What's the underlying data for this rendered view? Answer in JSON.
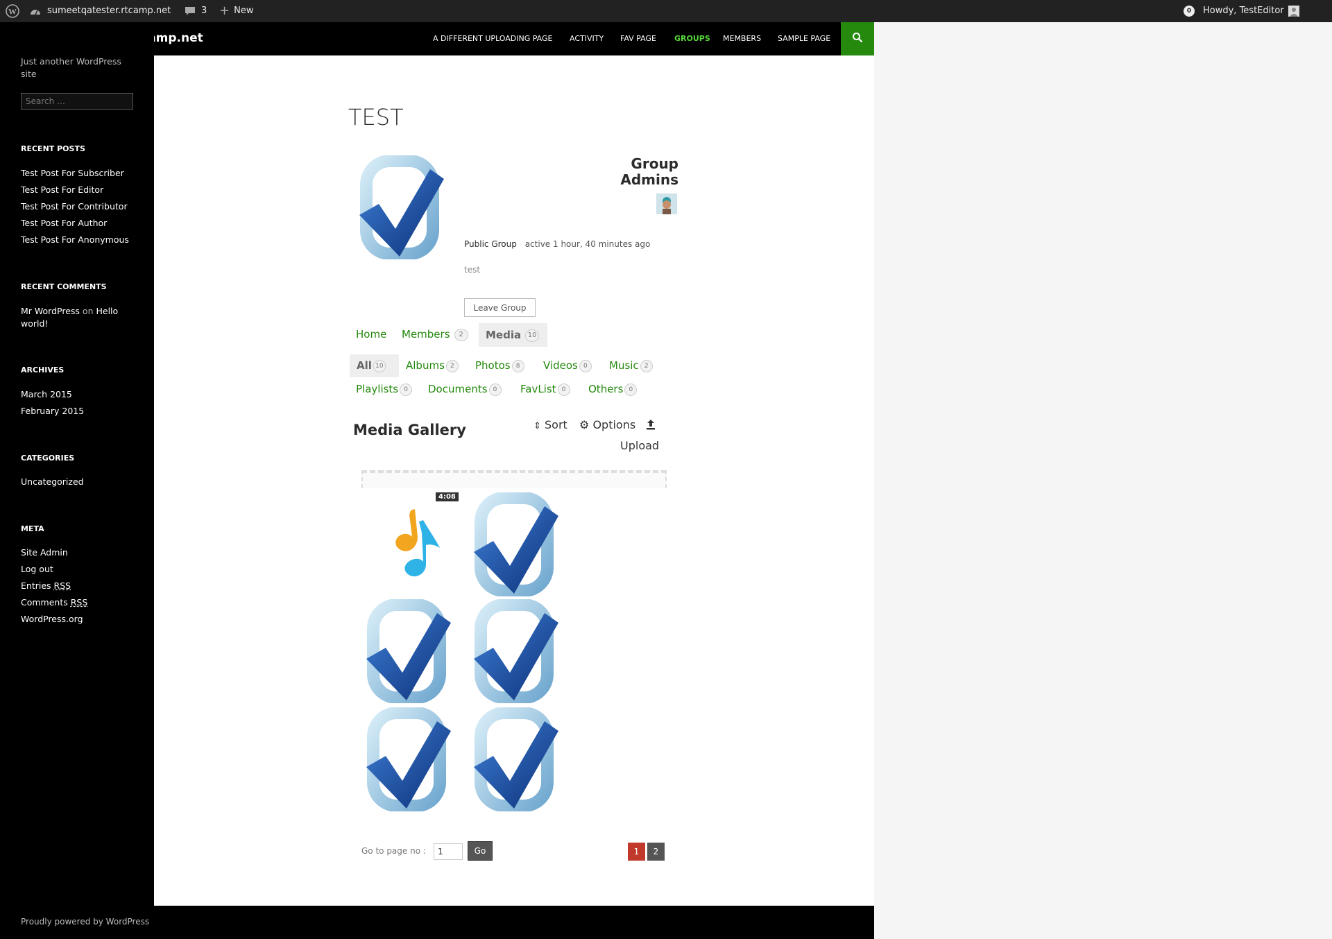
{
  "admin_bar": {
    "site_name": "sumeetqatester.rtcamp.net",
    "comments_count": "3",
    "new_label": "New",
    "notifications": "0",
    "howdy": "Howdy, TestEditor"
  },
  "header": {
    "site_title": "sumeetqatester.rtcamp.net",
    "nav": [
      {
        "label": "A DIFFERENT UPLOADING PAGE"
      },
      {
        "label": "ACTIVITY"
      },
      {
        "label": "FAV PAGE"
      },
      {
        "label": "GROUPS"
      },
      {
        "label": "MEMBERS"
      },
      {
        "label": "SAMPLE PAGE"
      }
    ]
  },
  "sidebar": {
    "tagline": "Just another WordPress site",
    "search_placeholder": "Search …",
    "recent_posts_heading": "RECENT POSTS",
    "recent_posts": [
      "Test Post For Subscriber",
      "Test Post For Editor",
      "Test Post For Contributor",
      "Test Post For Author",
      "Test Post For Anonymous"
    ],
    "recent_comments_heading": "RECENT COMMENTS",
    "comment_author": "Mr WordPress",
    "comment_on": "on",
    "comment_post": "Hello world!",
    "archives_heading": "ARCHIVES",
    "archives": [
      "March 2015",
      "February 2015"
    ],
    "categories_heading": "CATEGORIES",
    "categories": [
      "Uncategorized"
    ],
    "meta_heading": "META",
    "meta": {
      "site_admin": "Site Admin",
      "log_out": "Log out",
      "entries": "Entries",
      "comments": "Comments",
      "rss": "RSS",
      "wordpress_org": "WordPress.org"
    }
  },
  "group": {
    "title": "TEST",
    "admins_heading": "Group Admins",
    "type": "Public Group",
    "active": "active 1 hour, 40 minutes ago",
    "description": "test",
    "leave_button": "Leave Group",
    "tabs": [
      {
        "label": "Home",
        "count": ""
      },
      {
        "label": "Members",
        "count": "2"
      },
      {
        "label": "Media",
        "count": "10"
      }
    ],
    "media_filters_row1": [
      {
        "label": "All",
        "count": "10"
      },
      {
        "label": "Albums",
        "count": "2"
      },
      {
        "label": "Photos",
        "count": "8"
      },
      {
        "label": "Videos",
        "count": "0"
      },
      {
        "label": "Music",
        "count": "2"
      }
    ],
    "media_filters_row2": [
      {
        "label": "Playlists",
        "count": "0"
      },
      {
        "label": "Documents",
        "count": "0"
      },
      {
        "label": "FavList",
        "count": "0"
      },
      {
        "label": "Others",
        "count": "0"
      }
    ]
  },
  "gallery": {
    "heading": "Media Gallery",
    "sort_label": "Sort",
    "options_label": "Options",
    "upload_label": "Upload",
    "duration": "4:08",
    "goto_label": "Go to page no :",
    "goto_value": "1",
    "go_button": "Go",
    "pages": [
      "1",
      "2"
    ]
  },
  "footer": {
    "text": "Proudly powered by WordPress"
  },
  "colors": {
    "accent_green": "#24890d",
    "pagination_active": "#c0392b",
    "pagination_inactive": "#555555"
  }
}
